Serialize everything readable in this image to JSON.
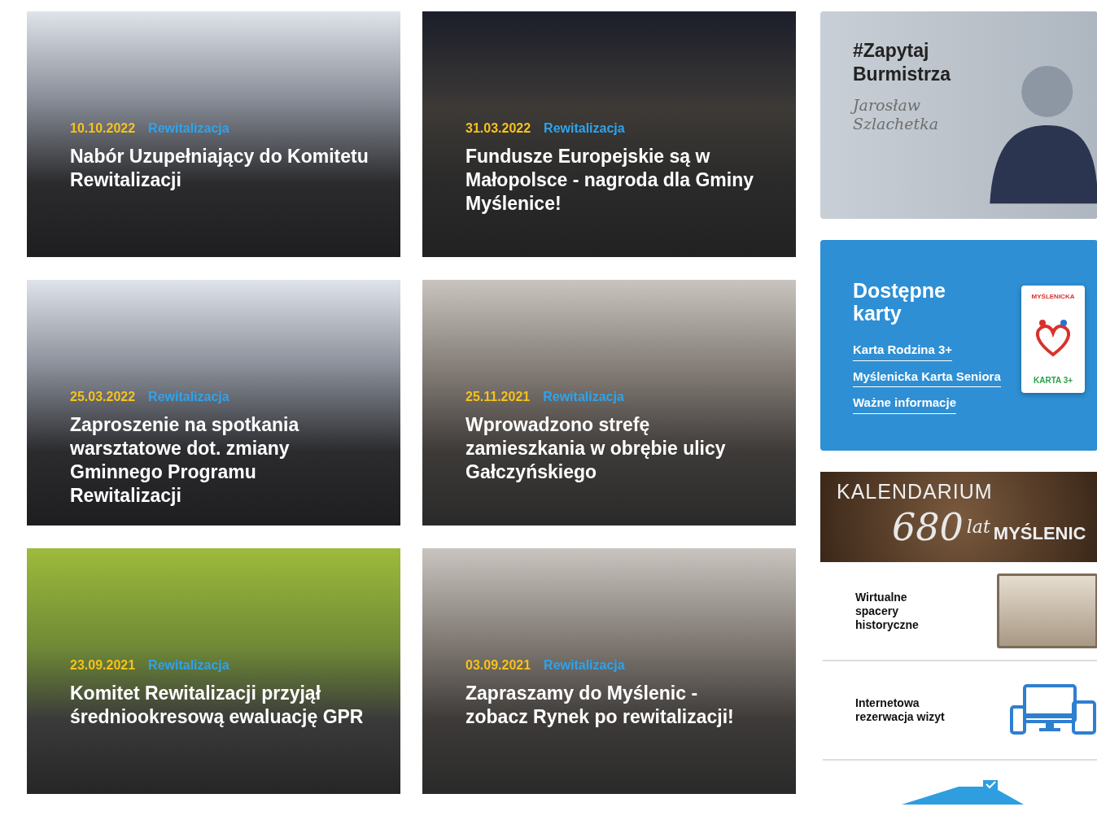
{
  "news": [
    {
      "date": "10.10.2022",
      "category": "Rewitalizacja",
      "title": "Nabór Uzupełniający do Komitetu Rewitalizacji"
    },
    {
      "date": "31.03.2022",
      "category": "Rewitalizacja",
      "title": "Fundusze Europejskie są w Małopolsce - nagroda dla Gminy Myślenice!"
    },
    {
      "date": "25.03.2022",
      "category": "Rewitalizacja",
      "title": "Zaproszenie na spotkania warsztatowe dot. zmiany Gminnego Programu Rewitalizacji"
    },
    {
      "date": "25.11.2021",
      "category": "Rewitalizacja",
      "title": "Wprowadzono strefę zamieszkania w obrębie ulicy Gałczyńskiego"
    },
    {
      "date": "23.09.2021",
      "category": "Rewitalizacja",
      "title": "Komitet Rewitalizacji przyjął średniookresową ewaluację GPR"
    },
    {
      "date": "03.09.2021",
      "category": "Rewitalizacja",
      "title": "Zapraszamy do Myślenic - zobacz Rynek po rewitalizacji!"
    }
  ],
  "sidebar": {
    "ask_banner": {
      "hashtag": "#Zapytaj Burmistrza",
      "signature": "Jarosław Szlachetka"
    },
    "cards_panel": {
      "title": "Dostępne karty",
      "links": [
        "Karta Rodzina 3+",
        "Myślenicka Karta Seniora",
        "Ważne informacje"
      ],
      "card_image": {
        "top": "MYŚLENICKA",
        "bottom": "KARTA 3+"
      }
    },
    "calendar_banner": {
      "title": "KALENDARIUM",
      "number": "680",
      "suffix": "lat",
      "town": "MYŚLENIC"
    },
    "services": [
      {
        "kind": "photo",
        "label": "Wirtualne spacery historyczne"
      },
      {
        "kind": "devices",
        "label": "Internetowa rezerwacja wizyt"
      }
    ]
  }
}
